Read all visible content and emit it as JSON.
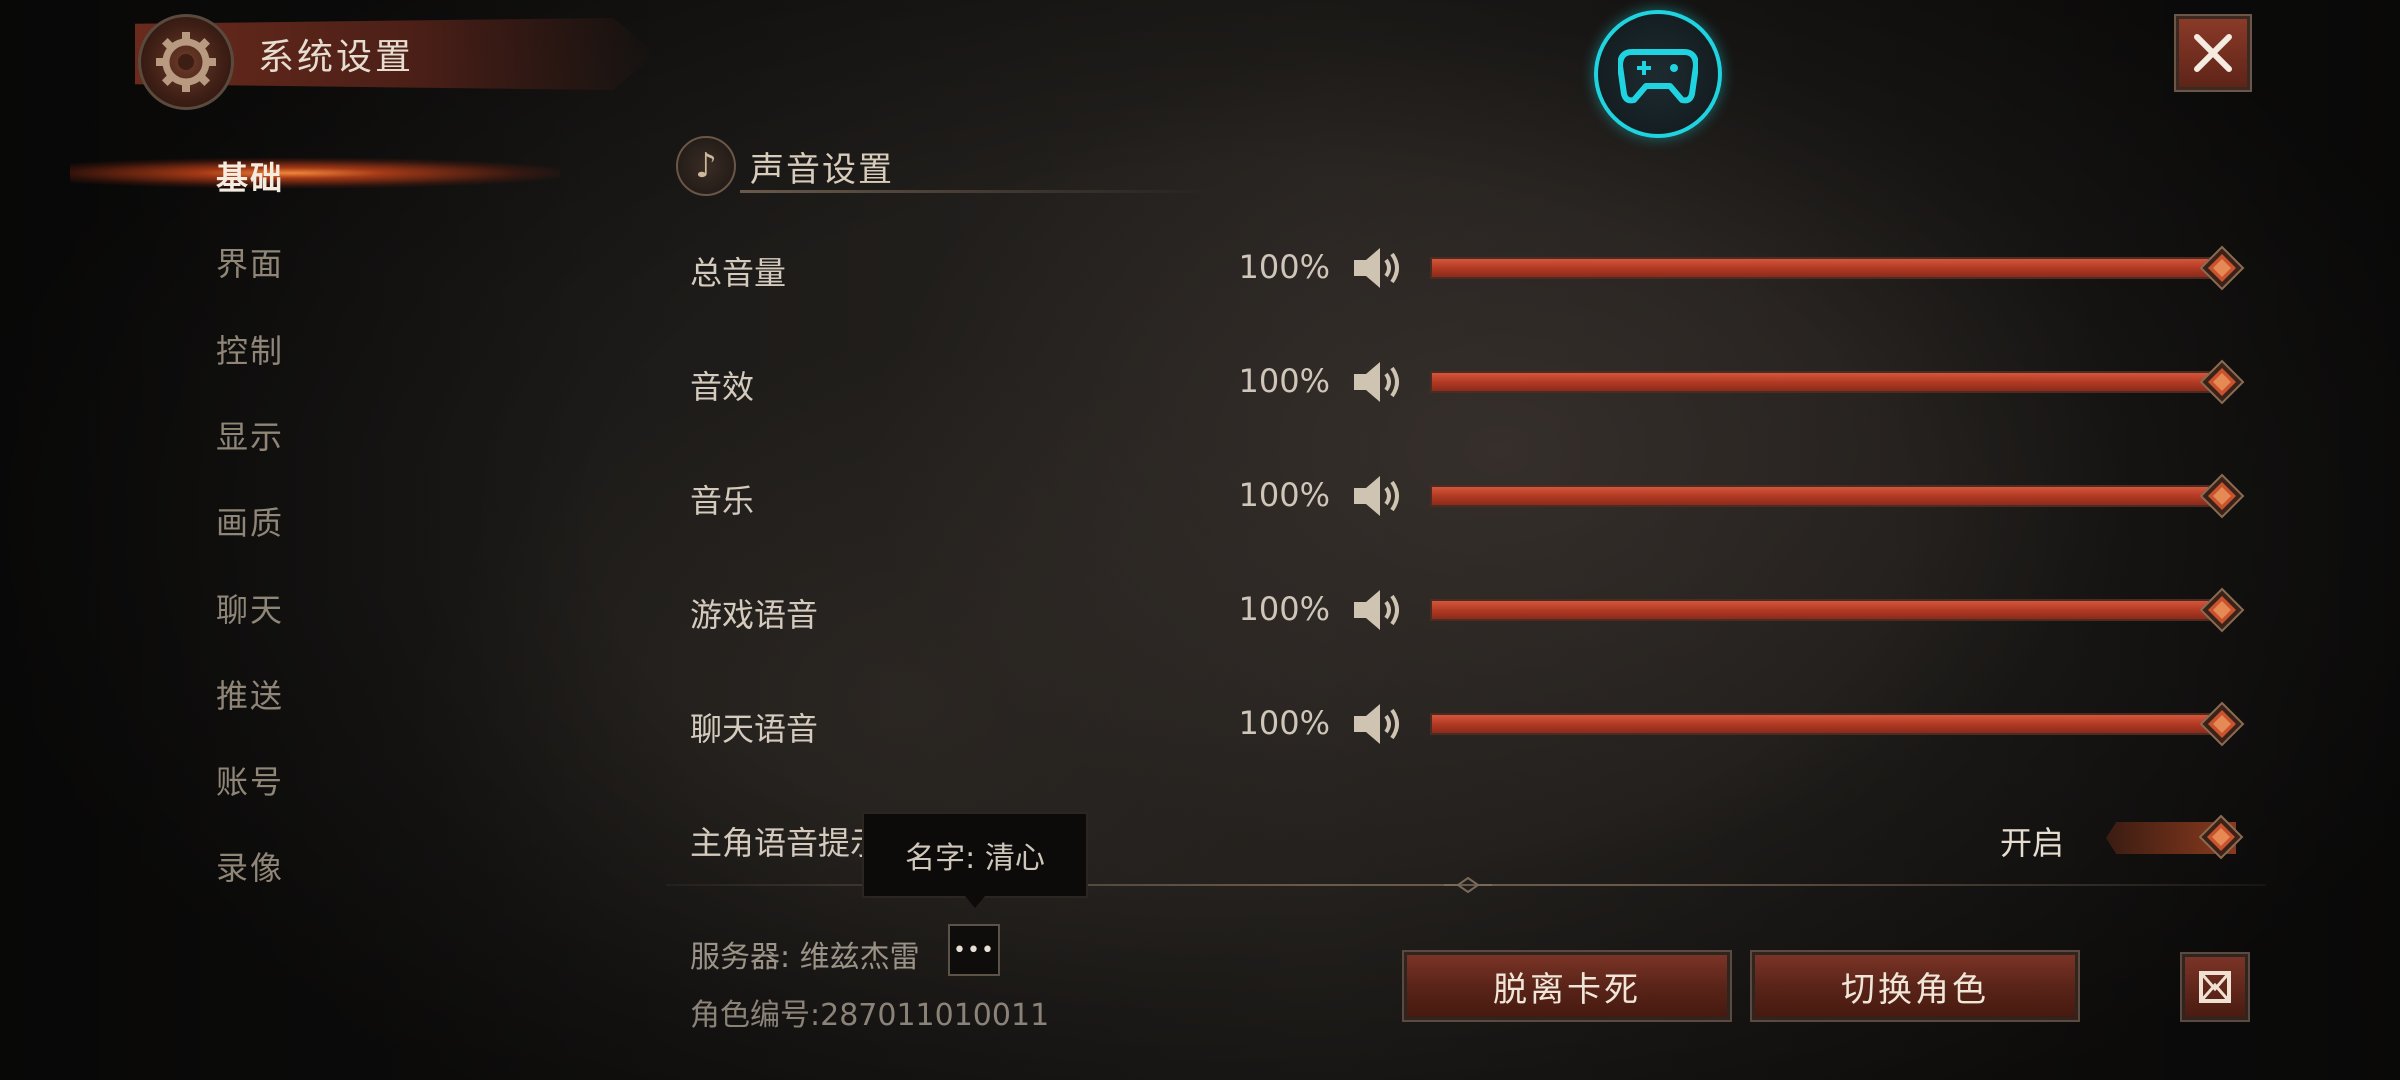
{
  "window": {
    "title": "系统设置"
  },
  "sidebar": {
    "items": [
      {
        "label": "基础",
        "active": true
      },
      {
        "label": "界面"
      },
      {
        "label": "控制"
      },
      {
        "label": "显示"
      },
      {
        "label": "画质"
      },
      {
        "label": "聊天"
      },
      {
        "label": "推送"
      },
      {
        "label": "账号"
      },
      {
        "label": "录像"
      }
    ]
  },
  "section": {
    "title": "声音设置"
  },
  "volume_rows": [
    {
      "label": "总音量",
      "value": "100%",
      "level": 1.0
    },
    {
      "label": "音效",
      "value": "100%",
      "level": 1.0
    },
    {
      "label": "音乐",
      "value": "100%",
      "level": 1.0
    },
    {
      "label": "游戏语音",
      "value": "100%",
      "level": 1.0
    },
    {
      "label": "聊天语音",
      "value": "100%",
      "level": 1.0
    }
  ],
  "toggle_row": {
    "label": "主角语音提示",
    "state": "开启",
    "on": true
  },
  "tooltip": {
    "text": "名字: 清心"
  },
  "account": {
    "server": "服务器: 维兹杰雷",
    "more_label": "•••",
    "character_id": "角色编号:287011010011"
  },
  "buttons": {
    "unstuck": "脱离卡死",
    "switch_character": "切换角色"
  },
  "icons": {
    "title": "gear-icon",
    "controller": "gamepad-icon",
    "close": "close-icon",
    "section": "music-note-icon",
    "speaker": "speaker-icon",
    "corner": "banner-icon"
  },
  "colors": {
    "accent": "#c0452b",
    "controller_ring": "#1fd4e0",
    "text": "#d4cabd"
  }
}
